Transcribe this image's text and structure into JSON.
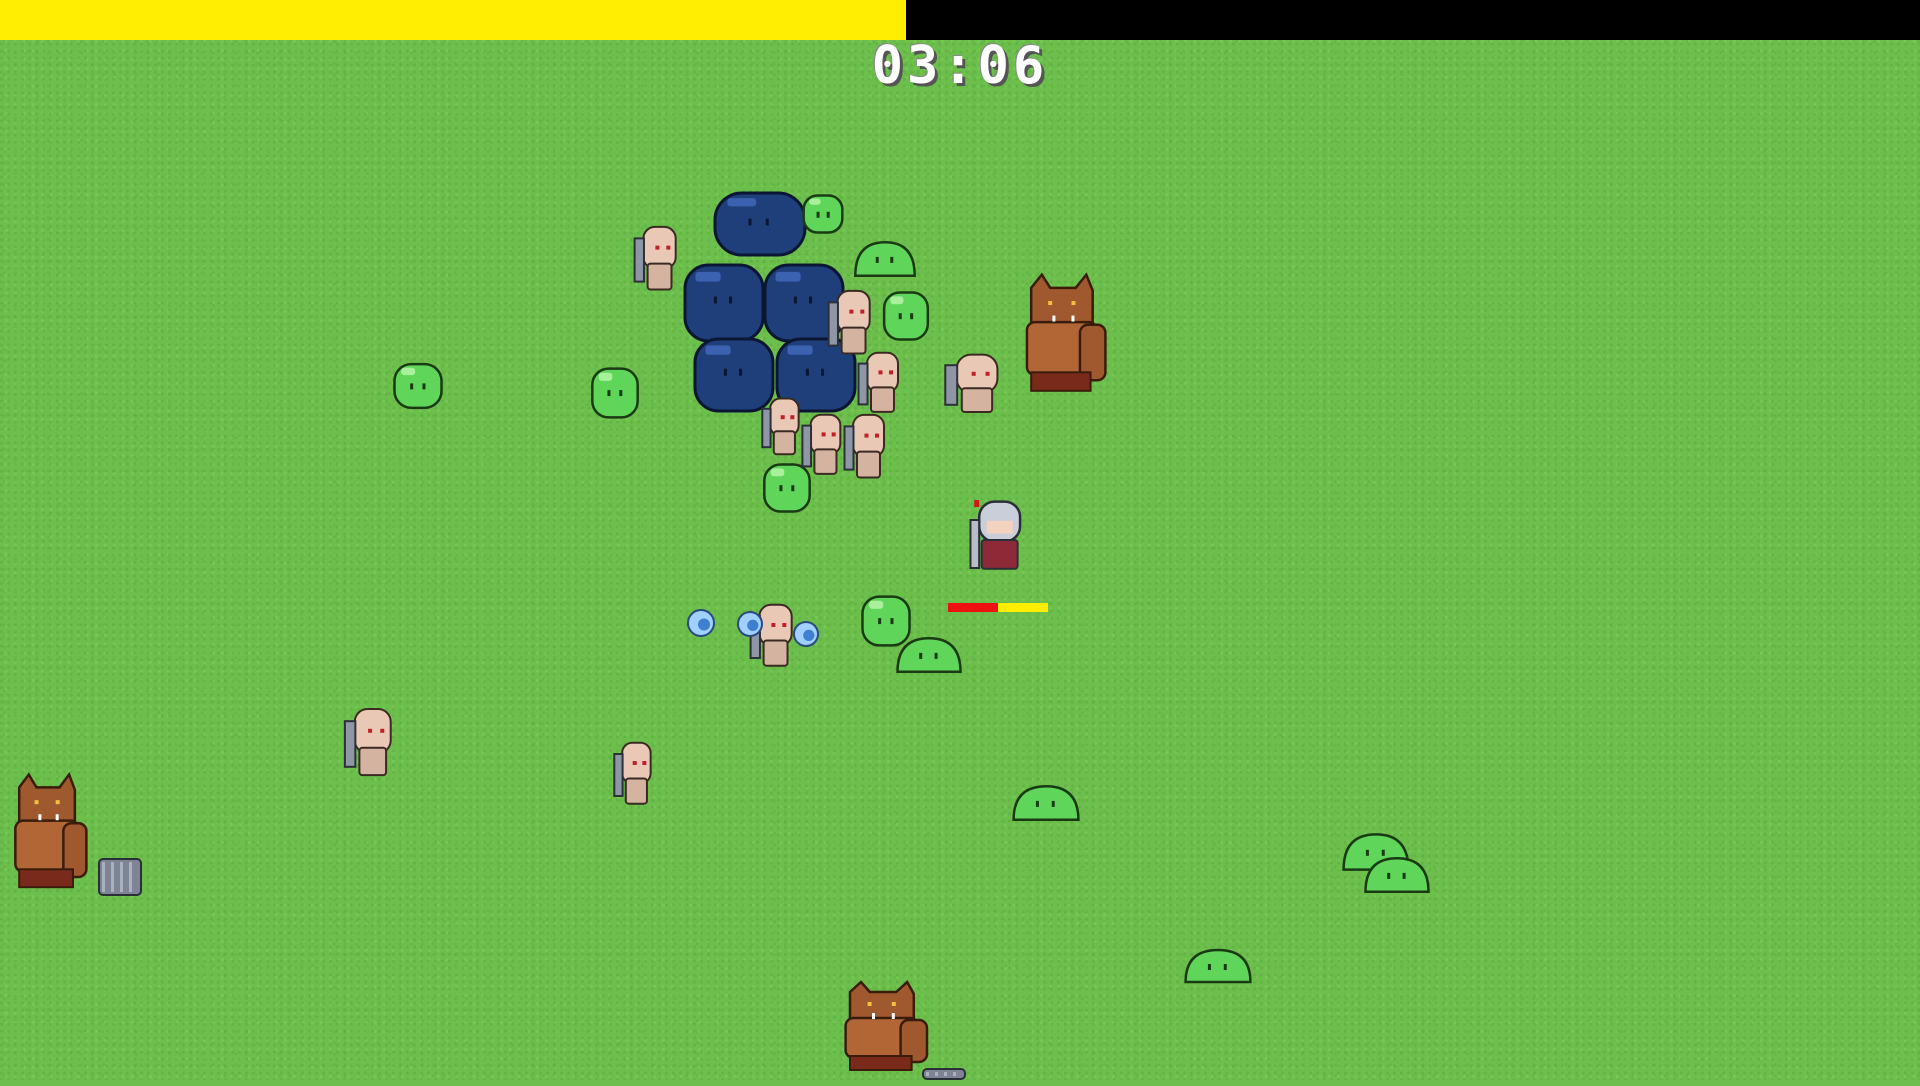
{
  "hud": {
    "timer": "03:06",
    "xp_progress": 0.472,
    "xp_color": "#ffee00",
    "player_hp_fraction": 0.5
  },
  "colors": {
    "grass": "#6cbf4c",
    "slime_green": "#5fd65a",
    "slime_dark_blue": "#1f3f7a",
    "ogre_brown": "#a0582f",
    "skeleton_bone": "#e9c9b6",
    "knight_steel": "#c9ced8",
    "orb_blue": "#9fd0ff"
  },
  "entities": [
    {
      "kind": "green-slime-enemy",
      "icon": "green-slime-icon"
    },
    {
      "kind": "dark-blue-slime-enemy",
      "icon": "dark-slime-icon"
    },
    {
      "kind": "skeleton-swordsman-enemy",
      "icon": "skeleton-icon"
    },
    {
      "kind": "ogre-brute-enemy",
      "icon": "ogre-icon"
    },
    {
      "kind": "experience-orb",
      "icon": "orb-icon"
    },
    {
      "kind": "knight-player",
      "icon": "knight-icon"
    }
  ]
}
